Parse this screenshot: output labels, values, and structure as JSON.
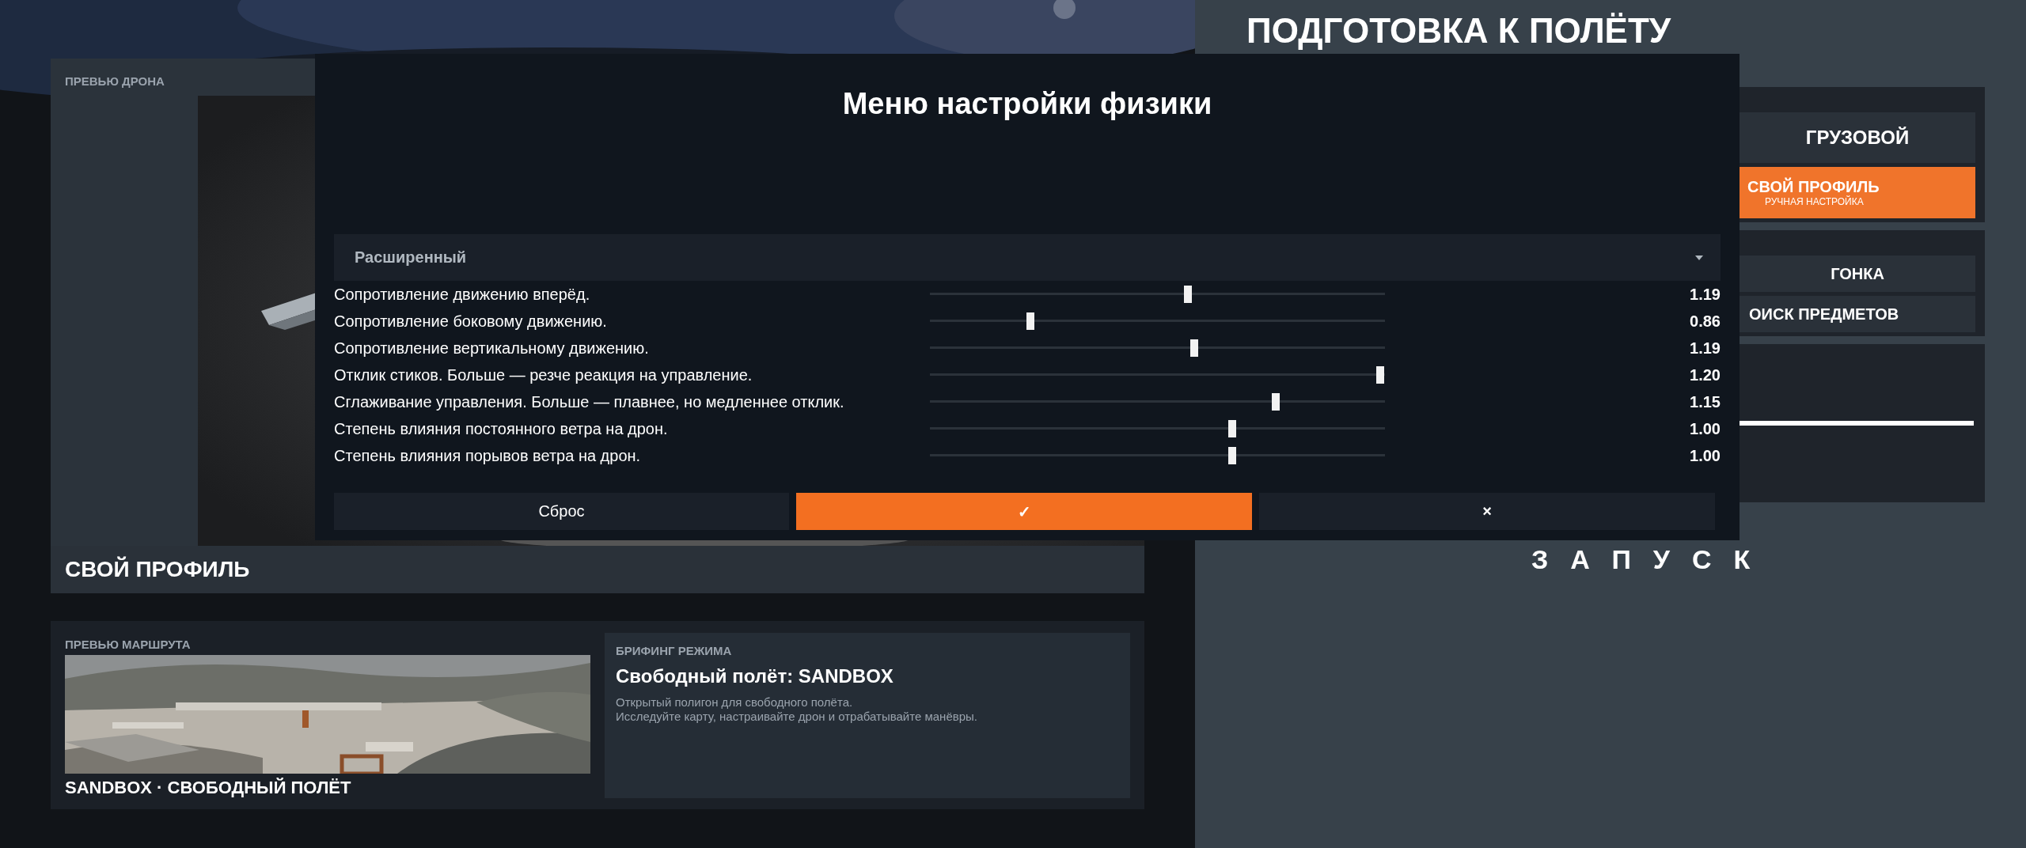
{
  "drone_preview": {
    "label": "ПРЕВЬЮ ДРОНА",
    "profile": "СВОЙ ПРОФИЛЬ"
  },
  "route_preview": {
    "label": "ПРЕВЬЮ МАРШРУТА",
    "caption": "SANDBOX · СВОБОДНЫЙ ПОЛЁТ"
  },
  "briefing": {
    "label": "БРИФИНГ РЕЖИМА",
    "title": "Свободный полёт: SANDBOX",
    "lines": [
      "Открытый полигон для свободного полёта.",
      "Исследуйте карту, настраивайте дрон и отрабатывайте манёвры."
    ]
  },
  "flight_prep": {
    "title": "ПОДГОТОВКА К ПОЛЁТУ",
    "profiles": [
      {
        "label": "ГРУЗОВОЙ",
        "selected": false
      },
      {
        "label": "СВОЙ ПРОФИЛЬ",
        "sublabel": "РУЧНАЯ НАСТРОЙКА",
        "selected": true
      }
    ],
    "modes": [
      {
        "label": "ГОНКА"
      },
      {
        "label": "ОИСК ПРЕДМЕТОВ"
      }
    ],
    "launch": "ЗАПУСК",
    "settings_panel": {
      "level": 1
    }
  },
  "physics_menu": {
    "title": "Меню настройки физики",
    "preset": "Расширенный",
    "settings": [
      {
        "label": "Сопротивление движению вперёд.",
        "level": 0.567,
        "value": "1.19"
      },
      {
        "label": "Сопротивление боковому движению.",
        "level": 0.22,
        "value": "0.86"
      },
      {
        "label": "Сопротивление вертикальному движению.",
        "level": 0.58,
        "value": "1.19"
      },
      {
        "label": "Отклик стиков. Больше — резче реакция на управление.",
        "level": 0.99,
        "value": "1.20"
      },
      {
        "label": "Сглаживание управления. Больше — плавнее, но медленнее отклик.",
        "level": 0.76,
        "value": "1.15"
      },
      {
        "label": "Степень влияния постоянного ветра на дрон.",
        "level": 0.664,
        "value": "1.00"
      },
      {
        "label": "Степень влияния порывов ветра на дрон.",
        "level": 0.664,
        "value": "1.00"
      }
    ],
    "buttons": [
      {
        "label": "Сброс",
        "kind": "reset"
      },
      {
        "label": "✓",
        "kind": "confirm"
      },
      {
        "label": "×",
        "kind": "cancel"
      }
    ]
  }
}
